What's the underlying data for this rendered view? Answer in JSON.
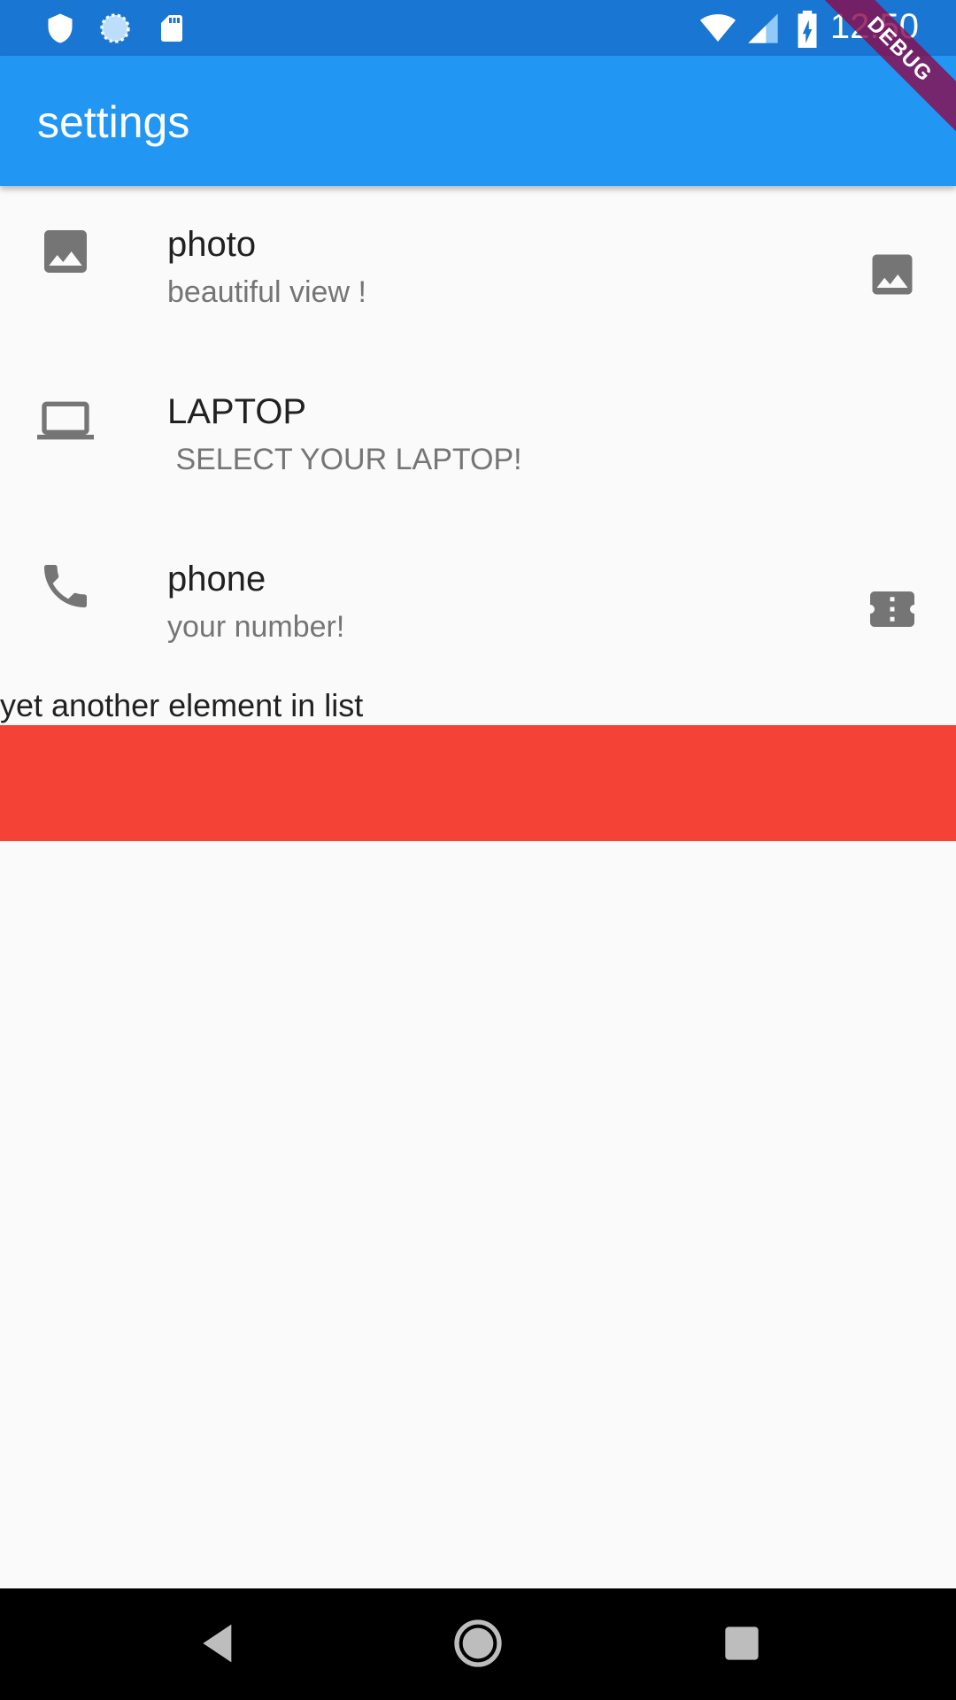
{
  "status_bar": {
    "time": "12:50",
    "icons": [
      "shield-icon",
      "sync-icon",
      "sd-card-icon",
      "wifi-icon",
      "signal-icon",
      "battery-charging-icon"
    ]
  },
  "app_bar": {
    "title": "settings",
    "debug_label": "DEBUG"
  },
  "list": {
    "items": [
      {
        "title": "photo",
        "subtitle": "beautiful view !",
        "leading_icon": "image-icon",
        "trailing_icon": "image-icon"
      },
      {
        "title": "LAPTOP",
        "subtitle": " SELECT YOUR LAPTOP!",
        "leading_icon": "laptop-icon",
        "trailing_icon": ""
      },
      {
        "title": "phone",
        "subtitle": "your number!",
        "leading_icon": "phone-icon",
        "trailing_icon": "ticket-icon"
      }
    ],
    "extra_text": "yet another element in list"
  },
  "colors": {
    "status_bar": "#1976d2",
    "app_bar": "#2196f3",
    "red_box": "#f44336",
    "background": "#fafafa"
  },
  "nav_bar": {
    "buttons": [
      "back-icon",
      "home-icon",
      "recents-icon"
    ]
  }
}
